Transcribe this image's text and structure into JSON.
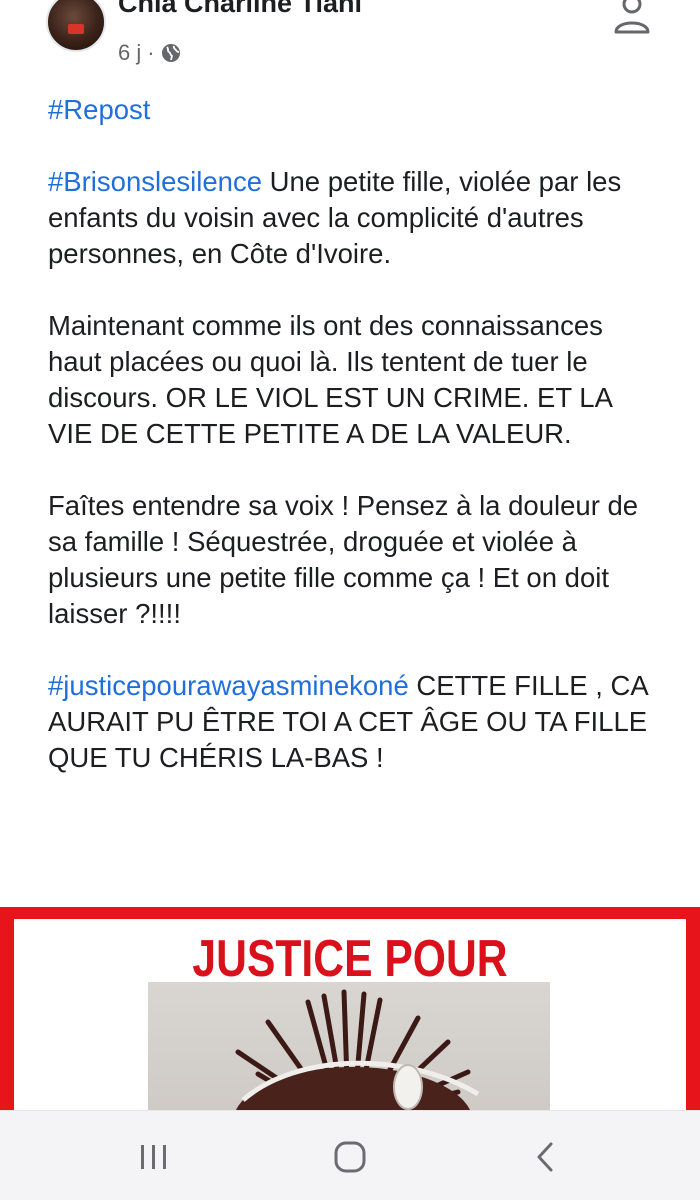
{
  "post": {
    "author": "Chia Charline Tiahi",
    "time": "6 j",
    "separator": "·",
    "paragraphs": [
      {
        "hashtag": "#Repost",
        "text": ""
      },
      {
        "hashtag": "#Brisonslesilence",
        "text": " Une petite fille, violée par les enfants du voisin avec la complicité d'autres personnes, en Côte d'Ivoire."
      },
      {
        "hashtag": "",
        "text": "Maintenant comme ils ont des connaissances haut placées ou quoi là. Ils tentent de tuer le discours. OR LE VIOL EST UN CRIME. ET LA VIE DE CETTE PETITE A DE LA VALEUR."
      },
      {
        "hashtag": "",
        "text": "Faîtes entendre sa voix ! Pensez à la douleur de sa famille ! Séquestrée, droguée et violée à plusieurs une petite fille comme ça ! Et on doit laisser ?!!!!"
      },
      {
        "hashtag": "#justicepourawayasminekoné",
        "text": " CETTE FILLE , CA AURAIT PU ÊTRE TOI A CET ÂGE OU TA FILLE QUE TU CHÉRIS LA-BAS !"
      }
    ],
    "image_title": "JUSTICE POUR"
  },
  "icons": {
    "avatar": "profile-photo",
    "globe": "globe-icon",
    "follow": "add-friend-icon",
    "nav_recent": "recent-apps-icon",
    "nav_home": "home-icon",
    "nav_back": "back-icon"
  },
  "colors": {
    "hashtag": "#216fdb",
    "image_border": "#e8141b",
    "image_title": "#d8111a",
    "meta": "#65676b"
  }
}
